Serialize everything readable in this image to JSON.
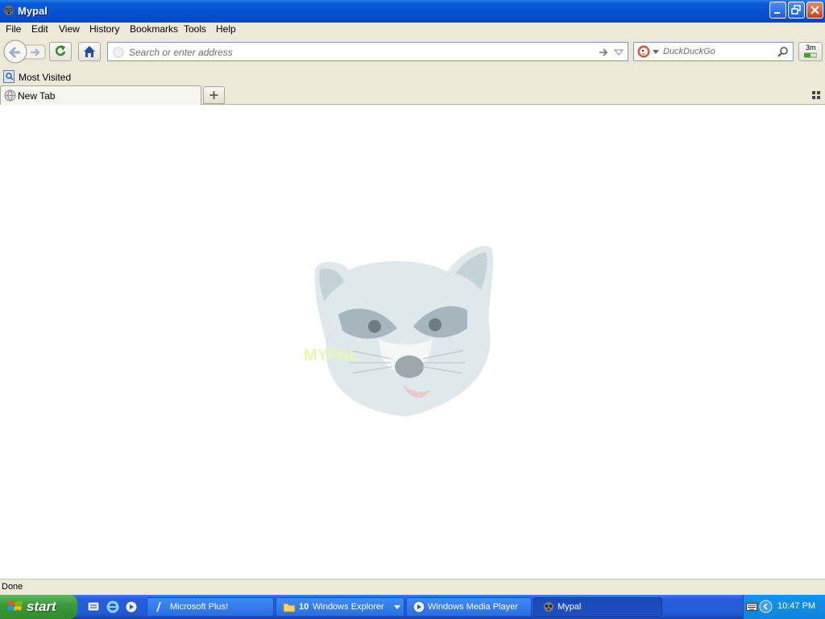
{
  "window": {
    "title": "Mypal"
  },
  "menu": [
    "File",
    "Edit",
    "View",
    "History",
    "Bookmarks",
    "Tools",
    "Help"
  ],
  "urlbar": {
    "placeholder": "Search or enter address"
  },
  "search": {
    "engine": "DuckDuckGo",
    "placeholder": "DuckDuckGo"
  },
  "toolbar_badge": "3m",
  "bookmarks": [
    {
      "label": "Most Visited"
    }
  ],
  "tabs": [
    {
      "label": "New Tab"
    }
  ],
  "content": {
    "logo_text": "MYPAL"
  },
  "status": "Done",
  "taskbar": {
    "start_label": "start",
    "items": [
      {
        "label": "Microsoft Plus!"
      },
      {
        "label": "10 Windows Explorer",
        "count": "10",
        "name": "Windows Explorer"
      },
      {
        "label": "Windows Media Player"
      },
      {
        "label": "Mypal"
      }
    ],
    "clock": "10:47 PM"
  },
  "colors": {
    "title_blue": "#0551d0",
    "chrome_beige": "#ece9d8",
    "start_green": "#3c9b3c",
    "taskbar_blue": "#235ad8"
  }
}
